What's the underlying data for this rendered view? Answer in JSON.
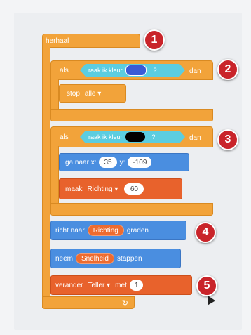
{
  "blocks": {
    "repeat_label": "herhaal",
    "if1": {
      "if_label": "als",
      "sense_label": "raak ik kleur",
      "q": "?",
      "then_label": "dan"
    },
    "stop": {
      "label": "stop",
      "option": "alle ▾"
    },
    "if2": {
      "if_label": "als",
      "sense_label": "raak ik kleur",
      "q": "?",
      "then_label": "dan"
    },
    "goto": {
      "label": "ga naar x:",
      "x": "35",
      "y_label": "y:",
      "y": "-109"
    },
    "make": {
      "label": "maak",
      "var": "Richting ▾",
      "value": "60"
    },
    "point": {
      "label": "richt naar",
      "var": "Richting",
      "suffix": "graden"
    },
    "move": {
      "label": "neem",
      "var": "Snelheid",
      "suffix": "stappen"
    },
    "change": {
      "label": "verander",
      "var": "Teller ▾",
      "mid": "met",
      "value": "1"
    },
    "loop_arrow": "↻"
  },
  "markers": [
    "1",
    "2",
    "3",
    "4",
    "5"
  ],
  "colors": {
    "control": "#f2a33a",
    "motion": "#4a8ee0",
    "variable": "#e8622c",
    "sensing": "#5ccde0",
    "marker": "#c9242a",
    "swatch1": "#3a5bd6",
    "swatch2": "#000000"
  }
}
